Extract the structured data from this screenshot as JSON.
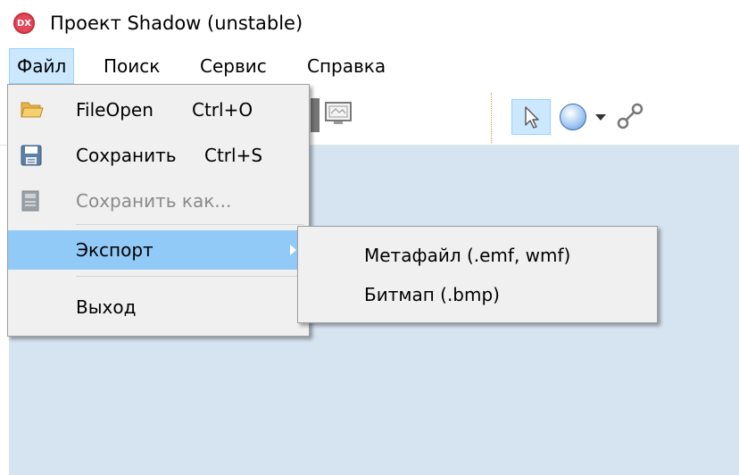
{
  "window": {
    "app_icon_text": "DX",
    "title": "Проект Shadow (unstable)"
  },
  "menubar": {
    "items": [
      "Файл",
      "Поиск",
      "Сервис",
      "Справка"
    ]
  },
  "file_menu": {
    "items": [
      {
        "label": "FileOpen",
        "shortcut": "Ctrl+O",
        "icon": "folder-open-icon",
        "enabled": true
      },
      {
        "label": "Сохранить",
        "shortcut": "Ctrl+S",
        "icon": "floppy-disk-icon",
        "enabled": true
      },
      {
        "label": "Сохранить как...",
        "shortcut": "",
        "icon": "save-as-icon",
        "enabled": false
      },
      {
        "label": "Экспорт",
        "shortcut": "",
        "icon": "",
        "enabled": true,
        "has_submenu": true,
        "highlighted": true
      },
      {
        "label": "Выход",
        "shortcut": "",
        "icon": "",
        "enabled": true
      }
    ]
  },
  "export_submenu": {
    "items": [
      "Метафайл (.emf, wmf)",
      "Битмап (.bmp)"
    ]
  },
  "toolbar": {
    "icons": [
      "screen-icon",
      "pointer-icon",
      "circle-shape-icon",
      "dropdown-arrow-icon",
      "link-icon"
    ],
    "active_tool": "pointer-icon"
  },
  "colors": {
    "highlight": "#91c9f7",
    "workspace": "#d6e3f1",
    "menu_bg": "#f0f0f0",
    "disabled_text": "#8a8a8a",
    "app_icon": "#e0485a"
  }
}
